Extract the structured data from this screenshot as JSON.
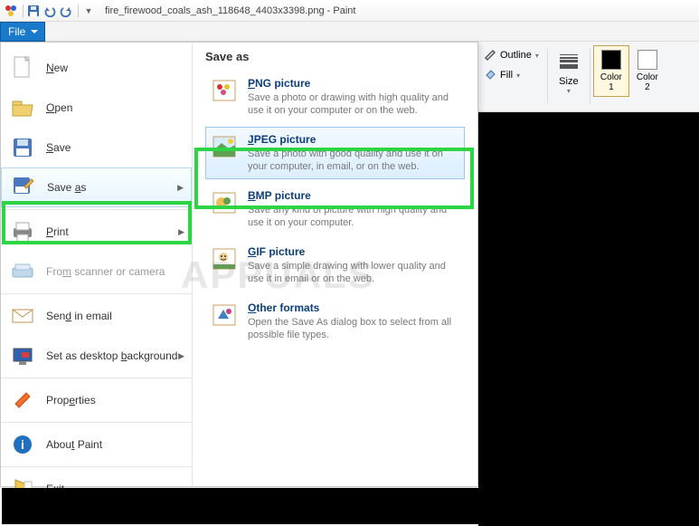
{
  "title": "fire_firewood_coals_ash_118648_4403x3398.png - Paint",
  "file_tab": "File",
  "ribbon": {
    "outline": "Outline",
    "fill": "Fill",
    "size": "Size",
    "color1": "Color\n1",
    "color2": "Color\n2"
  },
  "menu": {
    "new": "New",
    "open": "Open",
    "save": "Save",
    "save_as": "Save as",
    "print": "Print",
    "from_scanner": "From scanner or camera",
    "send_email": "Send in email",
    "set_bg": "Set as desktop background",
    "properties": "Properties",
    "about": "About Paint",
    "exit": "Exit"
  },
  "saveas_panel": {
    "title": "Save as",
    "png_t": "PNG picture",
    "png_d": "Save a photo or drawing with high quality and use it on your computer or on the web.",
    "jpeg_t": "JPEG picture",
    "jpeg_d": "Save a photo with good quality and use it on your computer, in email, or on the web.",
    "bmp_t": "BMP picture",
    "bmp_d": "Save any kind of picture with high quality and use it on your computer.",
    "gif_t": "GIF picture",
    "gif_d": "Save a simple drawing with lower quality and use it in email or on the web.",
    "other_t": "Other formats",
    "other_d": "Open the Save As dialog box to select from all possible file types."
  },
  "watermark": "APPUALS"
}
